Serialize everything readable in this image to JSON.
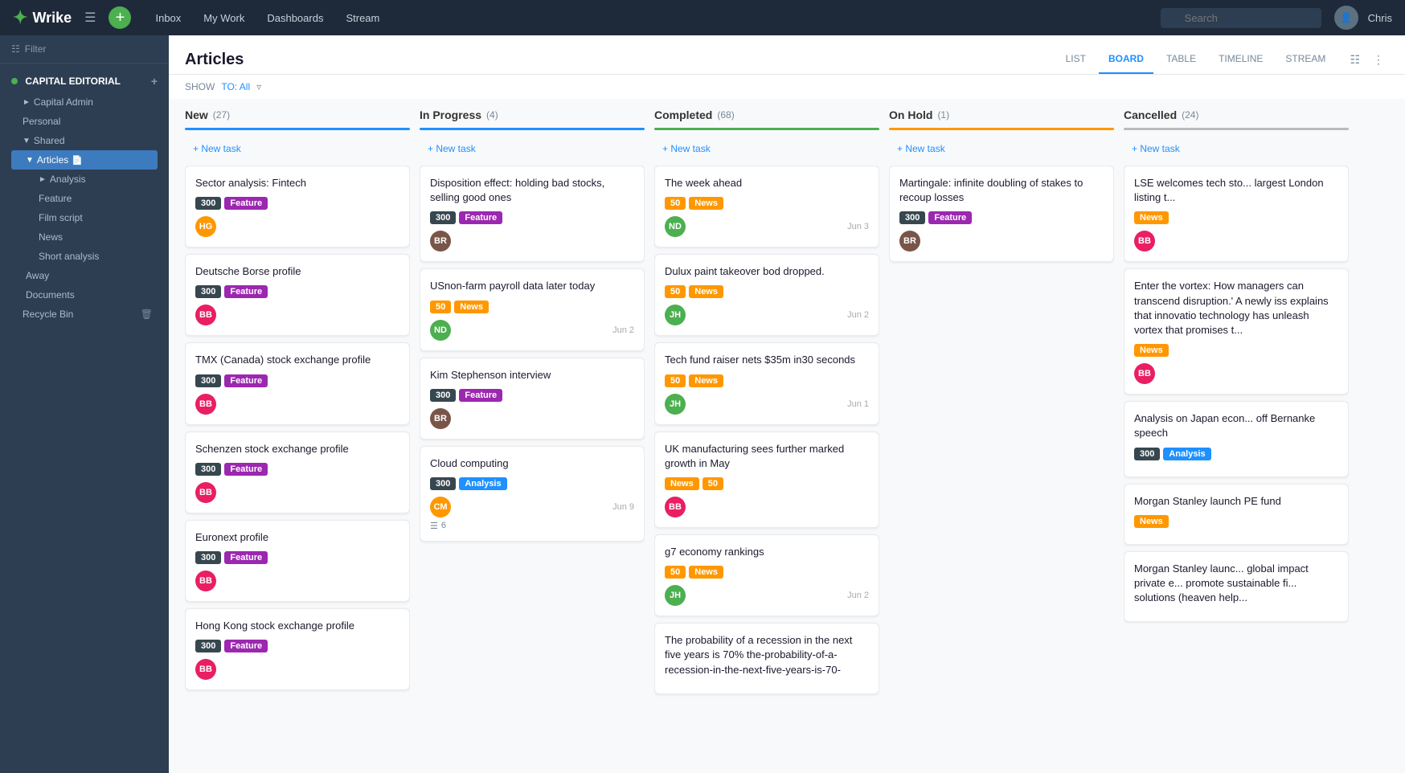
{
  "topnav": {
    "logo": "Wrike",
    "hamburger": "☰",
    "plus": "+",
    "items": [
      "Inbox",
      "My Work",
      "Dashboards",
      "Stream"
    ],
    "search_placeholder": "Search",
    "username": "Chris"
  },
  "sidebar": {
    "filter_label": "Filter",
    "group": "CAPITAL EDITORIAL",
    "items": [
      {
        "label": "Capital Admin",
        "indent": 0
      },
      {
        "label": "Personal",
        "indent": 0
      },
      {
        "label": "Shared",
        "indent": 0
      },
      {
        "label": "Articles",
        "indent": 1,
        "active": true
      },
      {
        "label": "Analysis",
        "indent": 2
      },
      {
        "label": "Feature",
        "indent": 2
      },
      {
        "label": "Film script",
        "indent": 2
      },
      {
        "label": "News",
        "indent": 2
      },
      {
        "label": "Short analysis",
        "indent": 2
      },
      {
        "label": "Away",
        "indent": 1
      },
      {
        "label": "Documents",
        "indent": 1
      },
      {
        "label": "Recycle Bin",
        "indent": 0
      }
    ]
  },
  "content": {
    "title": "Articles",
    "tabs": [
      "LIST",
      "BOARD",
      "TABLE",
      "TIMELINE",
      "STREAM"
    ],
    "active_tab": "BOARD",
    "show_label": "SHOW",
    "show_value": "TO: All"
  },
  "columns": [
    {
      "id": "new",
      "title": "New",
      "count": 27,
      "bar_class": "bar-new",
      "cards": [
        {
          "title": "Sector analysis: Fintech",
          "tags": [
            {
              "label": "300",
              "class": "tag-300"
            },
            {
              "label": "Feature",
              "class": "tag-feature"
            }
          ],
          "avatar": "HG",
          "av_class": "av-hg"
        },
        {
          "title": "Deutsche Borse profile",
          "tags": [
            {
              "label": "300",
              "class": "tag-300"
            },
            {
              "label": "Feature",
              "class": "tag-feature"
            }
          ],
          "avatar": "BB",
          "av_class": "av-bb"
        },
        {
          "title": "TMX (Canada) stock exchange profile",
          "tags": [
            {
              "label": "300",
              "class": "tag-300"
            },
            {
              "label": "Feature",
              "class": "tag-feature"
            }
          ],
          "avatar": "BB",
          "av_class": "av-bb"
        },
        {
          "title": "Schenzen stock exchange profile",
          "tags": [
            {
              "label": "300",
              "class": "tag-300"
            },
            {
              "label": "Feature",
              "class": "tag-feature"
            }
          ],
          "avatar": "BB",
          "av_class": "av-bb"
        },
        {
          "title": "Euronext profile",
          "tags": [
            {
              "label": "300",
              "class": "tag-300"
            },
            {
              "label": "Feature",
              "class": "tag-feature"
            }
          ],
          "avatar": "BB",
          "av_class": "av-bb"
        },
        {
          "title": "Hong Kong stock exchange profile",
          "tags": [
            {
              "label": "300",
              "class": "tag-300"
            },
            {
              "label": "Feature",
              "class": "tag-feature"
            }
          ],
          "avatar": "BB",
          "av_class": "av-bb"
        }
      ],
      "new_task_label": "+ New task"
    },
    {
      "id": "inprogress",
      "title": "In Progress",
      "count": 4,
      "bar_class": "bar-inprogress",
      "cards": [
        {
          "title": "Disposition effect: holding bad stocks, selling good ones",
          "tags": [
            {
              "label": "300",
              "class": "tag-300"
            },
            {
              "label": "Feature",
              "class": "tag-feature"
            }
          ],
          "avatar": "BR",
          "av_class": "av-br"
        },
        {
          "title": "USnon-farm payroll data later today",
          "tags": [
            {
              "label": "50",
              "class": "tag-50"
            },
            {
              "label": "News",
              "class": "tag-news"
            }
          ],
          "avatar": "ND",
          "av_class": "av-nd",
          "date": "Jun 2"
        },
        {
          "title": "Kim Stephenson interview",
          "tags": [
            {
              "label": "300",
              "class": "tag-300"
            },
            {
              "label": "Feature",
              "class": "tag-feature"
            }
          ],
          "avatar": "BR",
          "av_class": "av-br"
        },
        {
          "title": "Cloud computing",
          "tags": [
            {
              "label": "300",
              "class": "tag-300"
            },
            {
              "label": "Analysis",
              "class": "tag-analysis"
            }
          ],
          "avatar": "CM",
          "av_class": "av-cm",
          "date": "Jun 9",
          "subtask": "6"
        }
      ],
      "new_task_label": "+ New task"
    },
    {
      "id": "completed",
      "title": "Completed",
      "count": 68,
      "bar_class": "bar-completed",
      "cards": [
        {
          "title": "The week ahead",
          "tags": [
            {
              "label": "50",
              "class": "tag-50"
            },
            {
              "label": "News",
              "class": "tag-news"
            }
          ],
          "avatar": "ND",
          "av_class": "av-nd",
          "date": "Jun 3"
        },
        {
          "title": "Dulux paint takeover bod dropped.",
          "tags": [
            {
              "label": "50",
              "class": "tag-50"
            },
            {
              "label": "News",
              "class": "tag-news"
            }
          ],
          "avatar": "JH",
          "av_class": "av-jh",
          "date": "Jun 2"
        },
        {
          "title": "Tech fund raiser nets $35m in30 seconds",
          "tags": [
            {
              "label": "50",
              "class": "tag-50"
            },
            {
              "label": "News",
              "class": "tag-news"
            }
          ],
          "avatar": "JH",
          "av_class": "av-jh",
          "date": "Jun 1"
        },
        {
          "title": "UK manufacturing sees further marked growth in May",
          "tags": [
            {
              "label": "News",
              "class": "tag-news"
            },
            {
              "label": "50",
              "class": "tag-50"
            }
          ],
          "avatar": "BB",
          "av_class": "av-bb"
        },
        {
          "title": "g7 economy rankings",
          "tags": [
            {
              "label": "50",
              "class": "tag-50"
            },
            {
              "label": "News",
              "class": "tag-news"
            }
          ],
          "avatar": "JH",
          "av_class": "av-jh",
          "date": "Jun 2"
        },
        {
          "title": "The probability of a recession in the next five years is 70% the-probability-of-a-recession-in-the-next-five-years-is-70-",
          "tags": [],
          "avatar": "",
          "av_class": ""
        }
      ],
      "new_task_label": "+ New task"
    },
    {
      "id": "onhold",
      "title": "On Hold",
      "count": 1,
      "bar_class": "bar-onhold",
      "cards": [
        {
          "title": "Martingale: infinite doubling of stakes to recoup losses",
          "tags": [
            {
              "label": "300",
              "class": "tag-300"
            },
            {
              "label": "Feature",
              "class": "tag-feature"
            }
          ],
          "avatar": "BR",
          "av_class": "av-br"
        }
      ],
      "new_task_label": "+ New task"
    },
    {
      "id": "cancelled",
      "title": "Cancelled",
      "count": 24,
      "bar_class": "bar-cancelled",
      "cards": [
        {
          "title": "LSE welcomes tech sto... largest London listing t...",
          "tags": [
            {
              "label": "News",
              "class": "tag-news"
            }
          ],
          "avatar": "BB",
          "av_class": "av-bb"
        },
        {
          "title": "Enter the vortex: How managers can transcend disruption.' A newly iss explains that innovatio technology has unleash vortex that promises t...",
          "tags": [
            {
              "label": "News",
              "class": "tag-news"
            }
          ],
          "avatar": "BB",
          "av_class": "av-bb"
        },
        {
          "title": "Analysis on Japan econ... off Bernanke speech",
          "tags": [
            {
              "label": "300",
              "class": "tag-300"
            },
            {
              "label": "Analysis",
              "class": "tag-analysis"
            }
          ],
          "avatar": "",
          "av_class": ""
        },
        {
          "title": "Morgan Stanley launch PE fund",
          "tags": [
            {
              "label": "News",
              "class": "tag-news"
            }
          ],
          "avatar": "",
          "av_class": ""
        },
        {
          "title": "Morgan Stanley launc... global impact private e... promote sustainable fi... solutions (heaven help...",
          "tags": [],
          "avatar": "",
          "av_class": ""
        }
      ],
      "new_task_label": "+ New task"
    }
  ],
  "labels": {
    "new_task": "+ New task",
    "show": "SHOW",
    "to_all": "TO: All"
  }
}
